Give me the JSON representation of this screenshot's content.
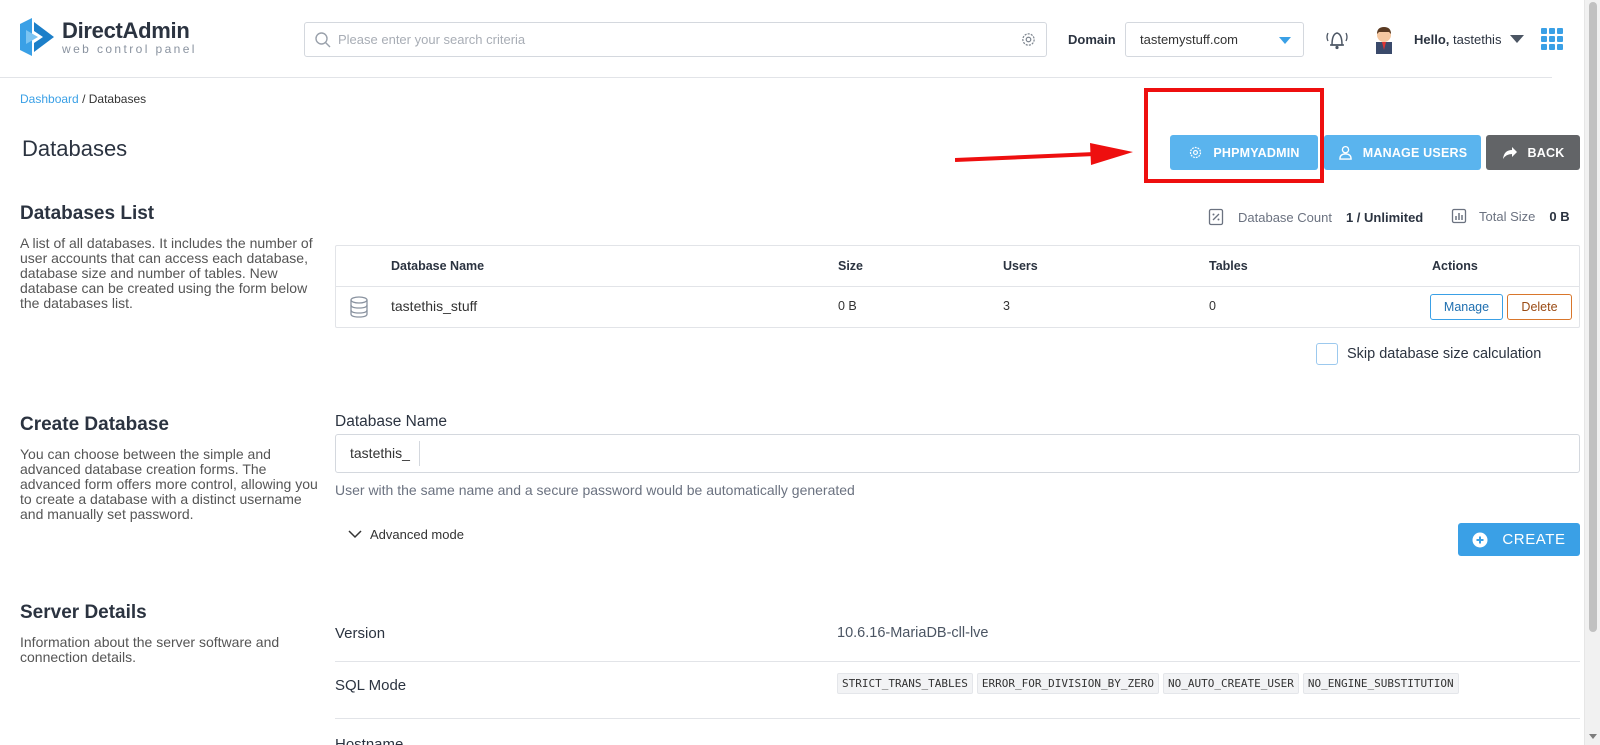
{
  "header": {
    "logo_name": "DirectAdmin",
    "logo_sub": "web control panel",
    "search_placeholder": "Please enter your search criteria",
    "domain_label": "Domain",
    "domain_value": "tastemystuff.com",
    "hello_prefix": "Hello,",
    "username": "tastethis"
  },
  "breadcrumb": {
    "home": "Dashboard",
    "separator": "/",
    "current": "Databases"
  },
  "page_title": "Databases",
  "actions": {
    "phpmyadmin": "PHPMYADMIN",
    "manage_users": "MANAGE USERS",
    "back": "BACK"
  },
  "databases_list": {
    "title": "Databases List",
    "description": "A list of all databases. It includes the number of user accounts that can access each database, database size and number of tables. New database can be created using the form below the databases list.",
    "count_label": "Database Count",
    "count_value": "1 / Unlimited",
    "size_label": "Total Size",
    "size_value": "0 B",
    "columns": [
      "Database Name",
      "Size",
      "Users",
      "Tables",
      "Actions"
    ],
    "rows": [
      {
        "name": "tastethis_stuff",
        "size": "0 B",
        "users": "3",
        "tables": "0",
        "manage": "Manage",
        "delete": "Delete"
      }
    ],
    "skip_label": "Skip database size calculation"
  },
  "create_database": {
    "title": "Create Database",
    "description": "You can choose between the simple and advanced database creation forms. The advanced form offers more control, allowing you to create a database with a distinct username and manually set password.",
    "field_label": "Database Name",
    "prefix": "tastethis_",
    "hint": "User with the same name and a secure password would be automatically generated",
    "advanced": "Advanced mode",
    "create": "CREATE"
  },
  "server_details": {
    "title": "Server Details",
    "description": "Information about the server software and connection details.",
    "version_label": "Version",
    "version_value": "10.6.16-MariaDB-cll-lve",
    "sql_mode_label": "SQL Mode",
    "sql_modes": [
      "STRICT_TRANS_TABLES",
      "ERROR_FOR_DIVISION_BY_ZERO",
      "NO_AUTO_CREATE_USER",
      "NO_ENGINE_SUBSTITUTION"
    ],
    "hostname_label": "Hostname"
  },
  "colors": {
    "accent": "#3aa0e6",
    "button": "#5ab4ee",
    "back_button": "#626467",
    "highlight": "#ee0f0f"
  }
}
